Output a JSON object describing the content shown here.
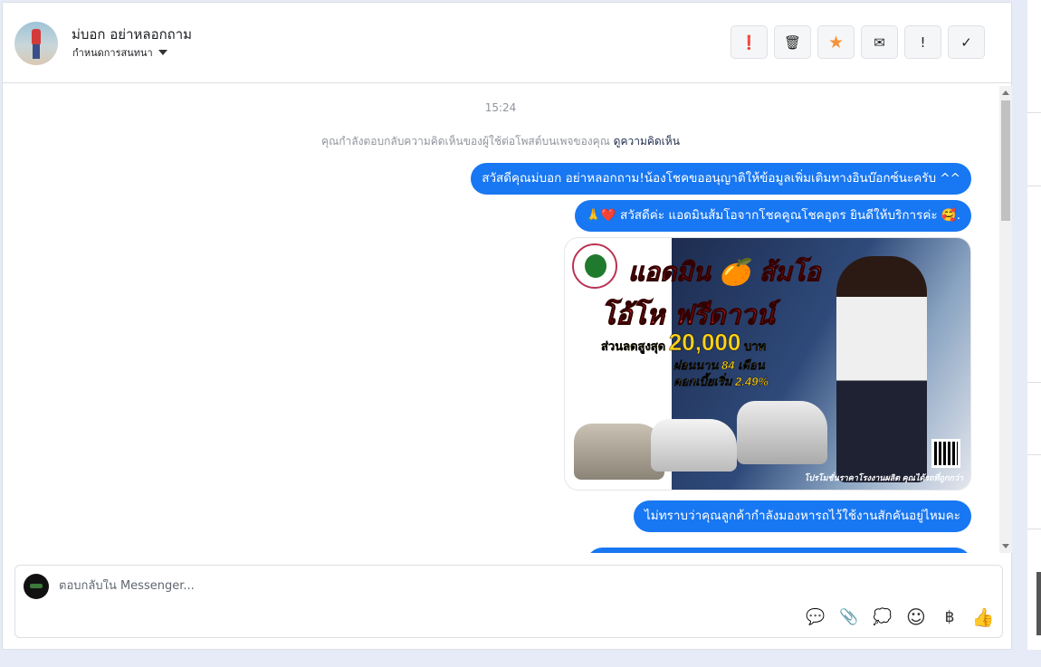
{
  "header": {
    "contact_name": "ม่บอก อย่าหลอกถาม",
    "conversation_settings": "กำหนดการสนทนา"
  },
  "actions": [
    {
      "icon": "alert-circle-icon",
      "glyph": "❗"
    },
    {
      "icon": "trash-icon",
      "glyph": "🗑"
    },
    {
      "icon": "star-icon",
      "glyph": "★",
      "color": "#f7923a"
    },
    {
      "icon": "envelope-icon",
      "glyph": "✉"
    },
    {
      "icon": "exclamation-icon",
      "glyph": "!"
    },
    {
      "icon": "check-icon",
      "glyph": "✓"
    }
  ],
  "thread": {
    "timestamp": "15:24",
    "notice": "คุณกำลังตอบกลับความคิดเห็นของผู้ใช้ต่อโพสต์บนเพจของคุณ",
    "notice_link": "ดูความคิดเห็น",
    "messages": [
      "สวัสดีคุณม่บอก อย่าหลอกถาม!น้องโชคขออนุญาติให้ข้อมูลเพิ่มเติมทางอินบ๊อกซ์นะครับ ^^",
      "🙏❤️ สวัสดีค่ะ แอดมินส้มโอจากโชคคูณโชคอุดร ยินดีให้บริการค่ะ 🥰.",
      "ไม่ทราบว่าคุณลูกค้ากำลังมองหารถไว้ใช้งานสักคันอยู่ไหมคะ"
    ],
    "ad_image": {
      "headline": "แอดมิน 🍊 ส้มโอ",
      "offer": "โอ้โห ฟรีดาวน์",
      "discount_label": "ส่วนลดสูงสุด",
      "discount_amount": "20,000",
      "currency": "บาท",
      "installment": "ผ่อนนาน 84 เดือน",
      "interest": "ดอกเบี้ยเริ่ม 2.49%",
      "footer": "โปรโมชั่นราคาโรงงานผลิต คุณได้รถที่ถูกกว่า"
    }
  },
  "composer": {
    "placeholder": "ตอบกลับใน Messenger...",
    "tools": [
      {
        "icon": "saved-reply-icon",
        "glyph": "💬"
      },
      {
        "icon": "paperclip-icon",
        "glyph": "📎"
      },
      {
        "icon": "chat-dots-icon",
        "glyph": "💭"
      },
      {
        "icon": "emoji-icon",
        "glyph": "☺"
      },
      {
        "icon": "baht-icon",
        "glyph": "฿"
      },
      {
        "icon": "thumbs-up-icon",
        "glyph": "👍"
      }
    ]
  },
  "colors": {
    "bubble": "#1877f2",
    "star": "#f7923a"
  }
}
